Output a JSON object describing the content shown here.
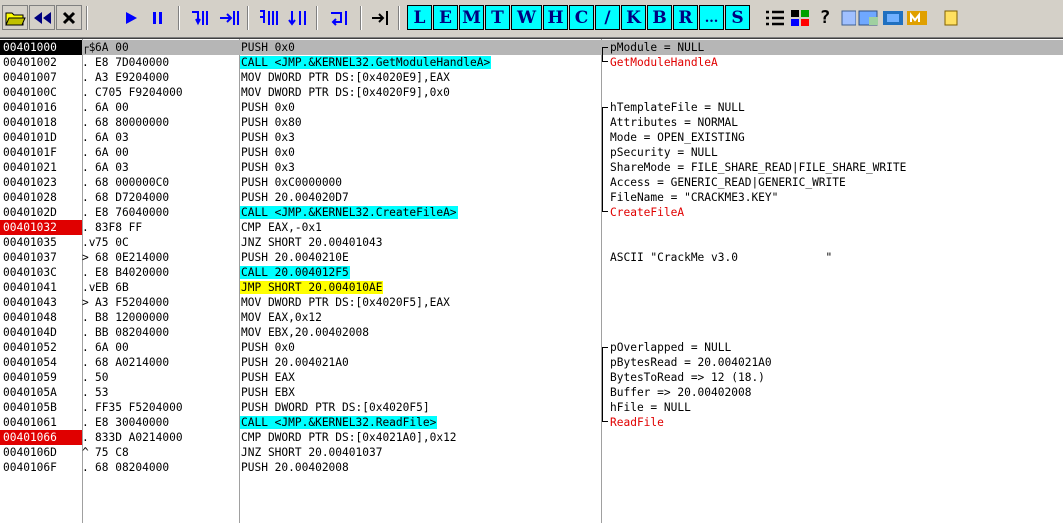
{
  "toolbar": {
    "command_buttons": [
      "L",
      "E",
      "M",
      "T",
      "W",
      "H",
      "C",
      "/",
      "K",
      "B",
      "R",
      "...",
      "S"
    ]
  },
  "rows": [
    {
      "addr": "00401000",
      "gutter": "┌$",
      "hex": "6A 00",
      "asm": "PUSH 0x0",
      "asm_style": "",
      "comment": "pModule = NULL",
      "addr_style": "hl"
    },
    {
      "addr": "00401002",
      "gutter": ".",
      "hex": "E8 7D040000",
      "asm": "CALL <JMP.&KERNEL32.GetModuleHandleA>",
      "asm_style": "call",
      "comment": "GetModuleHandleA",
      "comment_style": "red"
    },
    {
      "addr": "00401007",
      "gutter": ".",
      "hex": "A3 E9204000",
      "asm": "MOV DWORD PTR DS:[0x4020E9],EAX",
      "asm_style": "",
      "comment": ""
    },
    {
      "addr": "0040100C",
      "gutter": ".",
      "hex": "C705 F9204000",
      "asm": "MOV DWORD PTR DS:[0x4020F9],0x0",
      "asm_style": "",
      "comment": ""
    },
    {
      "addr": "00401016",
      "gutter": ".",
      "hex": "6A 00",
      "asm": "PUSH 0x0",
      "asm_style": "",
      "comment": "hTemplateFile = NULL"
    },
    {
      "addr": "00401018",
      "gutter": ".",
      "hex": "68 80000000",
      "asm": "PUSH 0x80",
      "asm_style": "",
      "comment": "Attributes = NORMAL"
    },
    {
      "addr": "0040101D",
      "gutter": ".",
      "hex": "6A 03",
      "asm": "PUSH 0x3",
      "asm_style": "",
      "comment": "Mode = OPEN_EXISTING"
    },
    {
      "addr": "0040101F",
      "gutter": ".",
      "hex": "6A 00",
      "asm": "PUSH 0x0",
      "asm_style": "",
      "comment": "pSecurity = NULL"
    },
    {
      "addr": "00401021",
      "gutter": ".",
      "hex": "6A 03",
      "asm": "PUSH 0x3",
      "asm_style": "",
      "comment": "ShareMode = FILE_SHARE_READ|FILE_SHARE_WRITE"
    },
    {
      "addr": "00401023",
      "gutter": ".",
      "hex": "68 000000C0",
      "asm": "PUSH 0xC0000000",
      "asm_style": "",
      "comment": "Access = GENERIC_READ|GENERIC_WRITE"
    },
    {
      "addr": "00401028",
      "gutter": ".",
      "hex": "68 D7204000",
      "asm": "PUSH 20.004020D7",
      "asm_style": "",
      "comment": "FileName = \"CRACKME3.KEY\""
    },
    {
      "addr": "0040102D",
      "gutter": ".",
      "hex": "E8 76040000",
      "asm": "CALL <JMP.&KERNEL32.CreateFileA>",
      "asm_style": "call",
      "comment": "CreateFileA",
      "comment_style": "red"
    },
    {
      "addr": "00401032",
      "gutter": ".",
      "hex": "83F8 FF",
      "asm": "CMP EAX,-0x1",
      "asm_style": "",
      "comment": "",
      "addr_style": "bp"
    },
    {
      "addr": "00401035",
      "gutter": ".v",
      "hex": "75 0C",
      "asm": "JNZ SHORT 20.00401043",
      "asm_style": "",
      "comment": ""
    },
    {
      "addr": "00401037",
      "gutter": ">",
      "hex": "68 0E214000",
      "asm": "PUSH 20.0040210E",
      "asm_style": "",
      "comment": "ASCII \"CrackMe v3.0             \""
    },
    {
      "addr": "0040103C",
      "gutter": ".",
      "hex": "E8 B4020000",
      "asm": "CALL 20.004012F5",
      "asm_style": "call",
      "comment": ""
    },
    {
      "addr": "00401041",
      "gutter": ".v",
      "hex": "EB 6B",
      "asm": "JMP SHORT 20.004010AE",
      "asm_style": "jmp",
      "comment": ""
    },
    {
      "addr": "00401043",
      "gutter": ">",
      "hex": "A3 F5204000",
      "asm": "MOV DWORD PTR DS:[0x4020F5],EAX",
      "asm_style": "",
      "comment": ""
    },
    {
      "addr": "00401048",
      "gutter": ".",
      "hex": "B8 12000000",
      "asm": "MOV EAX,0x12",
      "asm_style": "",
      "comment": ""
    },
    {
      "addr": "0040104D",
      "gutter": ".",
      "hex": "BB 08204000",
      "asm": "MOV EBX,20.00402008",
      "asm_style": "",
      "comment": ""
    },
    {
      "addr": "00401052",
      "gutter": ".",
      "hex": "6A 00",
      "asm": "PUSH 0x0",
      "asm_style": "",
      "comment": "pOverlapped = NULL"
    },
    {
      "addr": "00401054",
      "gutter": ".",
      "hex": "68 A0214000",
      "asm": "PUSH 20.004021A0",
      "asm_style": "",
      "comment": "pBytesRead = 20.004021A0"
    },
    {
      "addr": "00401059",
      "gutter": ".",
      "hex": "50",
      "asm": "PUSH EAX",
      "asm_style": "",
      "comment": "BytesToRead => 12 (18.)"
    },
    {
      "addr": "0040105A",
      "gutter": ".",
      "hex": "53",
      "asm": "PUSH EBX",
      "asm_style": "",
      "comment": "Buffer => 20.00402008"
    },
    {
      "addr": "0040105B",
      "gutter": ".",
      "hex": "FF35 F5204000",
      "asm": "PUSH DWORD PTR DS:[0x4020F5]",
      "asm_style": "",
      "comment": "hFile = NULL"
    },
    {
      "addr": "00401061",
      "gutter": ".",
      "hex": "E8 30040000",
      "asm": "CALL <JMP.&KERNEL32.ReadFile>",
      "asm_style": "call",
      "comment": "ReadFile",
      "comment_style": "red"
    },
    {
      "addr": "00401066",
      "gutter": ".",
      "hex": "833D A0214000",
      "asm": "CMP DWORD PTR DS:[0x4021A0],0x12",
      "asm_style": "",
      "comment": "",
      "addr_style": "bp"
    },
    {
      "addr": "0040106D",
      "gutter": "^",
      "hex": "75 C8",
      "asm": "JNZ SHORT 20.00401037",
      "asm_style": "",
      "comment": ""
    },
    {
      "addr": "0040106F",
      "gutter": ".",
      "hex": "68 08204000",
      "asm": "PUSH 20.00402008",
      "asm_style": "",
      "comment": ""
    }
  ]
}
